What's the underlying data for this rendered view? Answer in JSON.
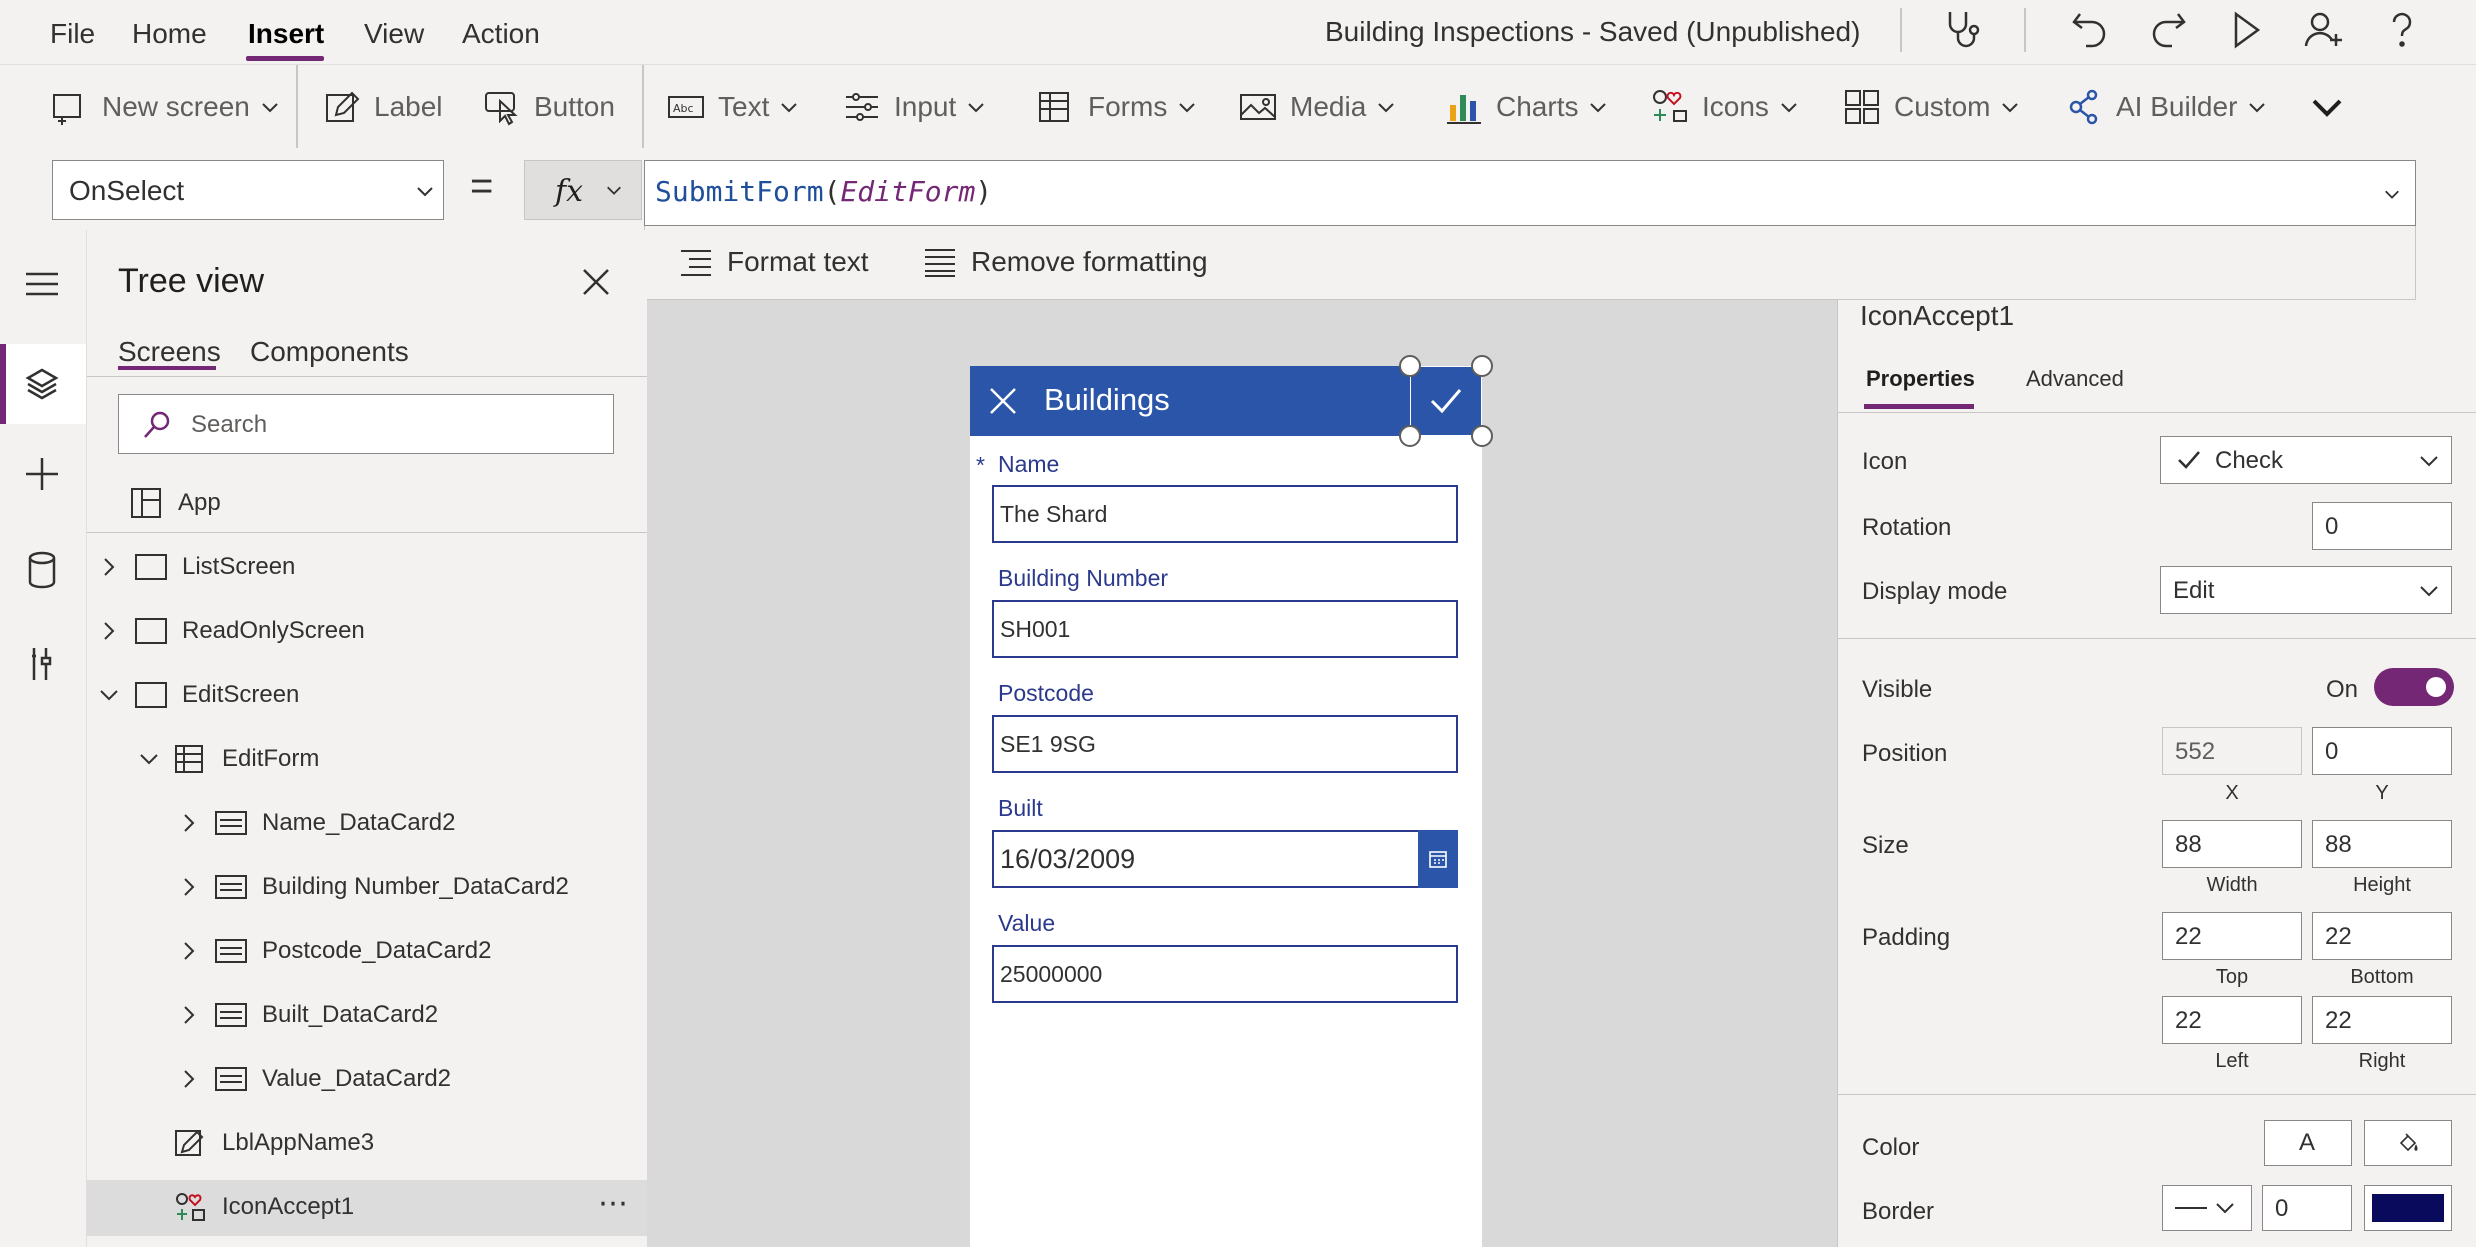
{
  "menu": {
    "file": "File",
    "home": "Home",
    "insert": "Insert",
    "view": "View",
    "action": "Action",
    "title": "Building Inspections - Saved (Unpublished)"
  },
  "ribbon": {
    "new_screen": "New screen",
    "label": "Label",
    "button": "Button",
    "text": "Text",
    "input": "Input",
    "forms": "Forms",
    "media": "Media",
    "charts": "Charts",
    "icons": "Icons",
    "custom": "Custom",
    "ai_builder": "AI Builder"
  },
  "formula": {
    "property": "OnSelect",
    "equals": "=",
    "fn": "SubmitForm",
    "open": "(",
    "arg": "EditForm",
    "close": ")",
    "format_text": "Format text",
    "remove_formatting": "Remove formatting"
  },
  "tree": {
    "title": "Tree view",
    "tab_screens": "Screens",
    "tab_components": "Components",
    "search_placeholder": "Search",
    "nodes": [
      "App",
      "ListScreen",
      "ReadOnlyScreen",
      "EditScreen",
      "EditForm",
      "Name_DataCard2",
      "Building Number_DataCard2",
      "Postcode_DataCard2",
      "Built_DataCard2",
      "Value_DataCard2",
      "LblAppName3",
      "IconAccept1"
    ],
    "more": "⋯"
  },
  "canvas": {
    "header_title": "Buildings",
    "fields": [
      {
        "label": "Name",
        "value": "The Shard",
        "required": "*"
      },
      {
        "label": "Building Number",
        "value": "SH001"
      },
      {
        "label": "Postcode",
        "value": "SE1 9SG"
      },
      {
        "label": "Built",
        "value": "16/03/2009"
      },
      {
        "label": "Value",
        "value": "25000000"
      }
    ]
  },
  "props": {
    "control_name": "IconAccept1",
    "tab_properties": "Properties",
    "tab_advanced": "Advanced",
    "icon_label": "Icon",
    "icon_value": "Check",
    "rotation_label": "Rotation",
    "rotation_value": "0",
    "display_mode_label": "Display mode",
    "display_mode_value": "Edit",
    "visible_label": "Visible",
    "visible_value": "On",
    "position_label": "Position",
    "pos_x": "552",
    "pos_y": "0",
    "x_label": "X",
    "y_label": "Y",
    "size_label": "Size",
    "width": "88",
    "height": "88",
    "width_label": "Width",
    "height_label": "Height",
    "padding_label": "Padding",
    "pad_top": "22",
    "pad_bottom": "22",
    "pad_left": "22",
    "pad_right": "22",
    "top_label": "Top",
    "bottom_label": "Bottom",
    "left_label": "Left",
    "right_label": "Right",
    "color_label": "Color",
    "color_text_glyph": "A",
    "border_label": "Border",
    "border_value": "0",
    "border_color": "#0a0a5c"
  },
  "colors": {
    "accent": "#742774",
    "form_header": "#2b55a8",
    "field_border": "#2b3a8c"
  }
}
